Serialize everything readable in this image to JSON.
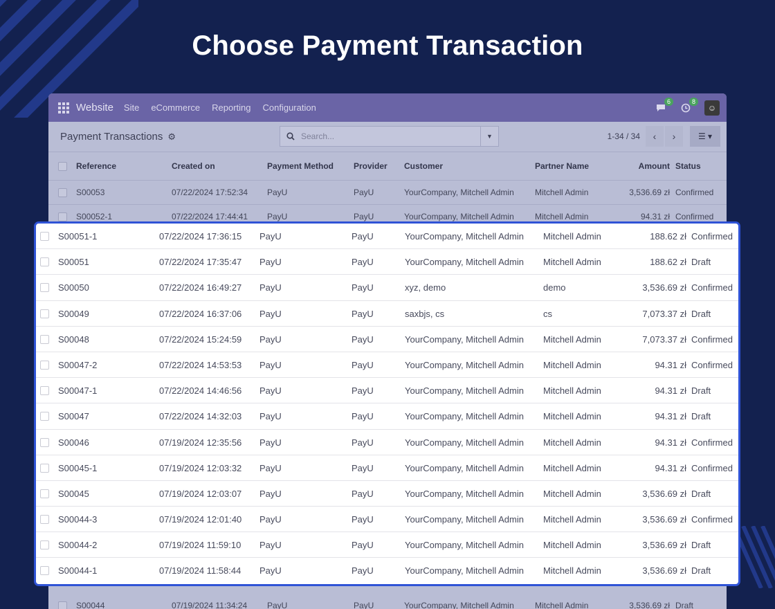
{
  "headline": "Choose Payment Transaction",
  "navbar": {
    "app_name": "Website",
    "menu": [
      "Site",
      "eCommerce",
      "Reporting",
      "Configuration"
    ],
    "messages_badge": "6",
    "activity_badge": "8"
  },
  "control_panel": {
    "title": "Payment Transactions",
    "search_placeholder": "Search...",
    "pager": "1-34 / 34"
  },
  "columns": [
    "Reference",
    "Created on",
    "Payment Method",
    "Provider",
    "Customer",
    "Partner Name",
    "Amount",
    "Status"
  ],
  "background_rows_top": [
    [
      "S00053",
      "07/22/2024 17:52:34",
      "PayU",
      "PayU",
      "YourCompany, Mitchell Admin",
      "Mitchell Admin",
      "3,536.69 zł",
      "Confirmed"
    ],
    [
      "S00052-1",
      "07/22/2024 17:44:41",
      "PayU",
      "PayU",
      "YourCompany, Mitchell Admin",
      "Mitchell Admin",
      "94.31 zł",
      "Confirmed"
    ]
  ],
  "background_rows_bottom": [
    [
      "S00044",
      "07/19/2024 11:34:24",
      "PayU",
      "PayU",
      "YourCompany, Mitchell Admin",
      "Mitchell Admin",
      "3,536.69 zł",
      "Draft"
    ]
  ],
  "highlight_rows": [
    [
      "S00051-1",
      "07/22/2024 17:36:15",
      "PayU",
      "PayU",
      "YourCompany, Mitchell Admin",
      "Mitchell Admin",
      "188.62 zł",
      "Confirmed"
    ],
    [
      "S00051",
      "07/22/2024 17:35:47",
      "PayU",
      "PayU",
      "YourCompany, Mitchell Admin",
      "Mitchell Admin",
      "188.62 zł",
      "Draft"
    ],
    [
      "S00050",
      "07/22/2024 16:49:27",
      "PayU",
      "PayU",
      "xyz, demo",
      "demo",
      "3,536.69 zł",
      "Confirmed"
    ],
    [
      "S00049",
      "07/22/2024 16:37:06",
      "PayU",
      "PayU",
      "saxbjs, cs",
      "cs",
      "7,073.37 zł",
      "Draft"
    ],
    [
      "S00048",
      "07/22/2024 15:24:59",
      "PayU",
      "PayU",
      "YourCompany, Mitchell Admin",
      "Mitchell Admin",
      "7,073.37 zł",
      "Confirmed"
    ],
    [
      "S00047-2",
      "07/22/2024 14:53:53",
      "PayU",
      "PayU",
      "YourCompany, Mitchell Admin",
      "Mitchell Admin",
      "94.31 zł",
      "Confirmed"
    ],
    [
      "S00047-1",
      "07/22/2024 14:46:56",
      "PayU",
      "PayU",
      "YourCompany, Mitchell Admin",
      "Mitchell Admin",
      "94.31 zł",
      "Draft"
    ],
    [
      "S00047",
      "07/22/2024 14:32:03",
      "PayU",
      "PayU",
      "YourCompany, Mitchell Admin",
      "Mitchell Admin",
      "94.31 zł",
      "Draft"
    ],
    [
      "S00046",
      "07/19/2024 12:35:56",
      "PayU",
      "PayU",
      "YourCompany, Mitchell Admin",
      "Mitchell Admin",
      "94.31 zł",
      "Confirmed"
    ],
    [
      "S00045-1",
      "07/19/2024 12:03:32",
      "PayU",
      "PayU",
      "YourCompany, Mitchell Admin",
      "Mitchell Admin",
      "94.31 zł",
      "Confirmed"
    ],
    [
      "S00045",
      "07/19/2024 12:03:07",
      "PayU",
      "PayU",
      "YourCompany, Mitchell Admin",
      "Mitchell Admin",
      "3,536.69 zł",
      "Draft"
    ],
    [
      "S00044-3",
      "07/19/2024 12:01:40",
      "PayU",
      "PayU",
      "YourCompany, Mitchell Admin",
      "Mitchell Admin",
      "3,536.69 zł",
      "Confirmed"
    ],
    [
      "S00044-2",
      "07/19/2024 11:59:10",
      "PayU",
      "PayU",
      "YourCompany, Mitchell Admin",
      "Mitchell Admin",
      "3,536.69 zł",
      "Draft"
    ],
    [
      "S00044-1",
      "07/19/2024 11:58:44",
      "PayU",
      "PayU",
      "YourCompany, Mitchell Admin",
      "Mitchell Admin",
      "3,536.69 zł",
      "Draft"
    ]
  ],
  "colors": {
    "page_background": "#13214f",
    "highlight_border": "#2f53d6",
    "navbar": "#6a64a6",
    "badge": "#4aa35e"
  }
}
